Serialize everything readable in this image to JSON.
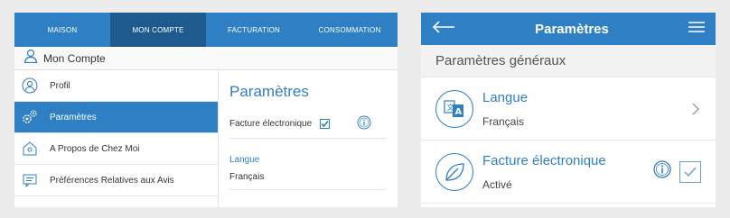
{
  "desktop": {
    "nav": {
      "tabs": [
        "MAISON",
        "MON COMPTE",
        "FACTURATION",
        "CONSOMMATION"
      ],
      "active_tab": "MON COMPTE"
    },
    "account_title": "Mon Compte",
    "sidebar": {
      "items": [
        {
          "label": "Profil",
          "icon": "user-circle-icon"
        },
        {
          "label": "Paramètres",
          "icon": "gears-icon"
        },
        {
          "label": "A Propos de Chez Moi",
          "icon": "house-icon"
        },
        {
          "label": "Préférences Relatives aux Avis",
          "icon": "notice-icon"
        }
      ],
      "active_item": "Paramètres"
    },
    "content": {
      "title": "Paramètres",
      "ebill_label": "Facture électronique",
      "ebill_checked": true,
      "language_label": "Langue",
      "language_value": "Français"
    }
  },
  "mobile": {
    "header_title": "Paramètres",
    "section_title": "Paramètres généraux",
    "language": {
      "title": "Langue",
      "value": "Français"
    },
    "ebill": {
      "title": "Facture électronique",
      "value": "Activé",
      "checked": true
    }
  },
  "colors": {
    "accent": "#2f7fc4",
    "accent_dark": "#1f5a8f",
    "background": "#ececec"
  }
}
